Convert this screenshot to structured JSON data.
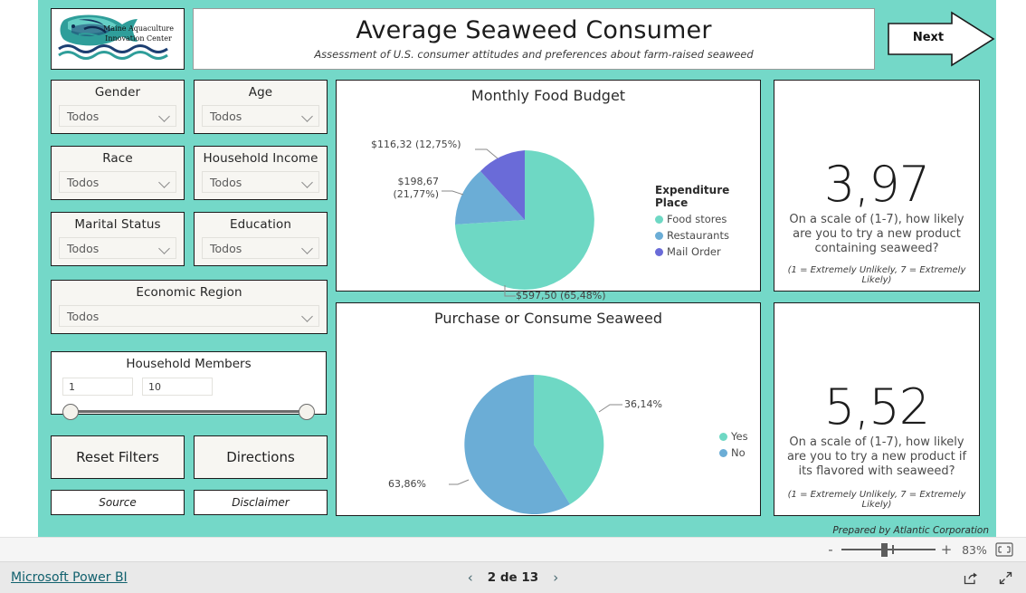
{
  "theme": {
    "canvas_bg": "#74d8c8",
    "card_bg": "#ffffff",
    "slicer_bg": "#f7f6f2",
    "accent_teal": "#6ed8c4",
    "accent_blue": "#6badd6",
    "accent_purple": "#6a6bd8",
    "link_color": "#12616e"
  },
  "header": {
    "logo": {
      "name": "maine-aquaculture-innovation-center-logo",
      "line1": "Maine Aquaculture",
      "line2": "Innovation Center"
    },
    "title": "Average Seaweed Consumer",
    "subtitle": "Assessment of U.S. consumer attitudes and preferences about farm-raised seaweed",
    "next_button": "Next"
  },
  "filters": [
    {
      "label": "Gender",
      "value": "Todos"
    },
    {
      "label": "Age",
      "value": "Todos"
    },
    {
      "label": "Race",
      "value": "Todos"
    },
    {
      "label": "Household Income",
      "value": "Todos"
    },
    {
      "label": "Marital Status",
      "value": "Todos"
    },
    {
      "label": "Education",
      "value": "Todos"
    },
    {
      "label": "Economic Region",
      "value": "Todos"
    }
  ],
  "household_members": {
    "label": "Household Members",
    "min_value": "1",
    "max_value": "10"
  },
  "actions": {
    "reset_filters": "Reset Filters",
    "directions": "Directions",
    "source": "Source",
    "disclaimer": "Disclaimer"
  },
  "kpi_cards": [
    {
      "value": "3,97",
      "question": "On a scale of (1-7), how likely are you to try a new product containing seaweed?",
      "footnote": "(1 = Extremely Unlikely, 7 = Extremely Likely)"
    },
    {
      "value": "5,52",
      "question": "On a scale of (1-7), how likely are you to try a new product if its flavored with seaweed?",
      "footnote": "(1 = Extremely Unlikely, 7 = Extremely Likely)"
    }
  ],
  "footer_note": "Prepared by Atlantic Corporation",
  "zoom_bar": {
    "minus": "-",
    "plus": "+",
    "percent": "83%",
    "fit_icon": "fit-to-page-icon"
  },
  "powerbi_footer": {
    "brand_link": "Microsoft Power BI",
    "prev_arrow": "‹",
    "next_arrow": "›",
    "page_label": "2 de 13",
    "share_icon": "share-icon",
    "fullscreen_icon": "fullscreen-icon"
  },
  "chart_data": [
    {
      "type": "pie",
      "title": "Monthly Food Budget",
      "legend_title": "Expenditure Place",
      "legend_position": "right",
      "categories": [
        "Food stores",
        "Restaurants",
        "Mail Order"
      ],
      "values": [
        597.5,
        198.67,
        116.32
      ],
      "percents": [
        65.48,
        21.77,
        12.75
      ],
      "data_labels": [
        "$597,50 (65,48%)",
        "$198,67\n(21,77%)",
        "$116,32 (12,75%)"
      ],
      "colors": [
        "#6ed8c4",
        "#6badd6",
        "#6a6bd8"
      ]
    },
    {
      "type": "pie",
      "title": "Purchase or Consume Seaweed",
      "legend_title": "",
      "legend_position": "right",
      "categories": [
        "Yes",
        "No"
      ],
      "values": [
        36.14,
        63.86
      ],
      "percents": [
        36.14,
        63.86
      ],
      "data_labels": [
        "36,14%",
        "63,86%"
      ],
      "colors": [
        "#6ed8c4",
        "#6badd6"
      ]
    }
  ]
}
